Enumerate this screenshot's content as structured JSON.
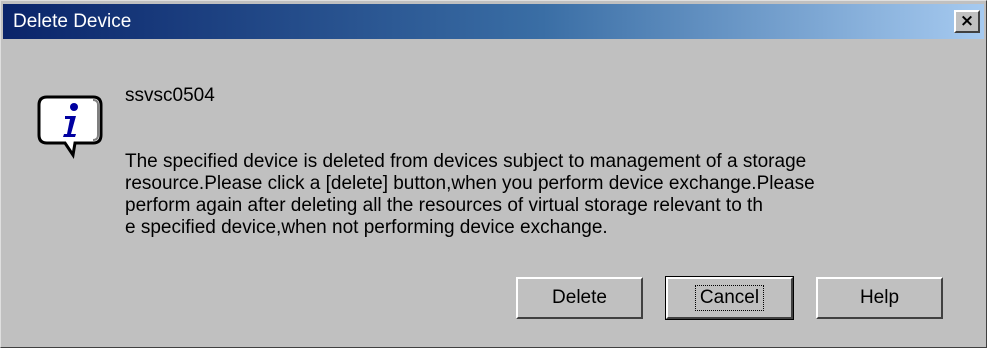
{
  "window": {
    "title": "Delete Device",
    "close_symbol": "×"
  },
  "message": {
    "icon": "information-speech-bubble-icon",
    "id": "ssvsc0504",
    "lines": [
      "The specified device is deleted from devices subject to management of a storage",
      "resource.Please click a [delete] button,when you perform device exchange.Please",
      "perform again after deleting all the resources of virtual storage relevant to th",
      "e specified device,when not performing device exchange."
    ]
  },
  "buttons": {
    "delete": "Delete",
    "cancel": "Cancel",
    "help": "Help"
  },
  "colors": {
    "face": "#c0c0c0",
    "title_start": "#0a246a",
    "title_end": "#a6caf0",
    "icon_letter": "#0000a0"
  }
}
